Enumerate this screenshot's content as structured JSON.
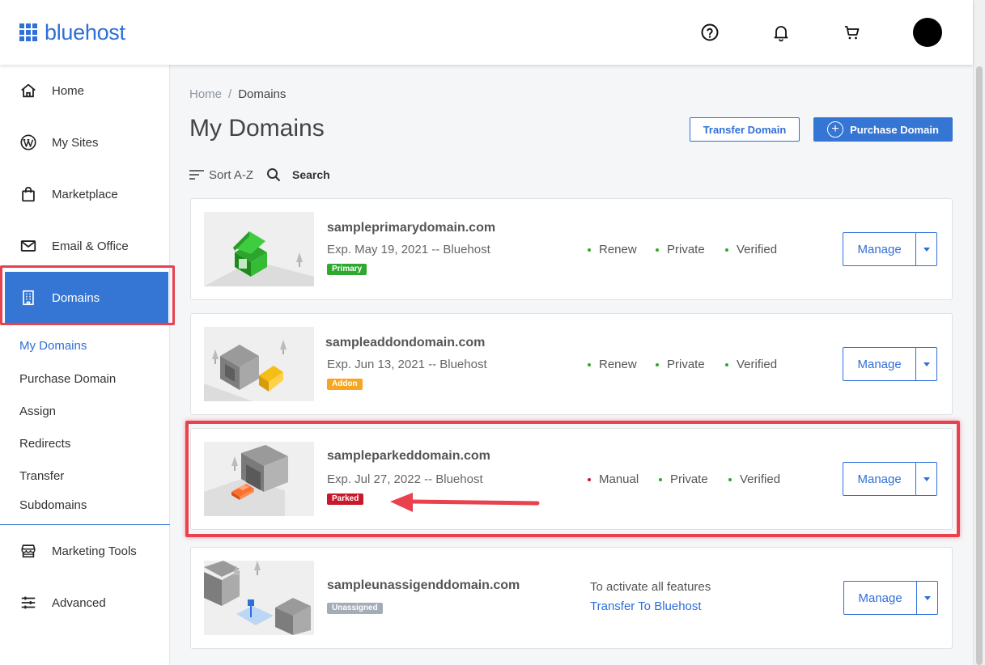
{
  "header": {
    "logo_text": "bluehost",
    "icons": [
      "help-icon",
      "bell-icon",
      "cart-icon",
      "avatar"
    ]
  },
  "sidebar": {
    "items": [
      {
        "label": "Home",
        "icon": "home-icon"
      },
      {
        "label": "My Sites",
        "icon": "wordpress-icon"
      },
      {
        "label": "Marketplace",
        "icon": "shopping-bag-icon"
      },
      {
        "label": "Email & Office",
        "icon": "envelope-icon"
      },
      {
        "label": "Domains",
        "icon": "building-icon"
      },
      {
        "label": "Marketing Tools",
        "icon": "storefront-icon"
      },
      {
        "label": "Advanced",
        "icon": "sliders-icon"
      }
    ],
    "sub_items": [
      "My Domains",
      "Purchase Domain",
      "Assign",
      "Redirects",
      "Transfer",
      "Subdomains"
    ]
  },
  "breadcrumb": {
    "home": "Home",
    "separator": "/",
    "current": "Domains"
  },
  "page_title": "My Domains",
  "buttons": {
    "transfer": "Transfer Domain",
    "purchase": "Purchase Domain",
    "plus": "+"
  },
  "toolbar": {
    "sort": "Sort A-Z",
    "search": "Search"
  },
  "domains": [
    {
      "name": "sampleprimarydomain.com",
      "expiry": "Exp. May 19, 2021 -- Bluehost",
      "tag": "Primary",
      "tag_color": "#2ea82e",
      "statuses": [
        {
          "label": "Renew",
          "color": "#2ea82e"
        },
        {
          "label": "Private",
          "color": "#2ea82e"
        },
        {
          "label": "Verified",
          "color": "#2ea82e"
        }
      ],
      "manage": "Manage"
    },
    {
      "name": "sampleaddondomain.com",
      "expiry": "Exp. Jun 13, 2021 -- Bluehost",
      "tag": "Addon",
      "tag_color": "#f5a623",
      "statuses": [
        {
          "label": "Renew",
          "color": "#2ea82e"
        },
        {
          "label": "Private",
          "color": "#2ea82e"
        },
        {
          "label": "Verified",
          "color": "#2ea82e"
        }
      ],
      "manage": "Manage"
    },
    {
      "name": "sampleparkeddomain.com",
      "expiry": "Exp. Jul 27, 2022 -- Bluehost",
      "tag": "Parked",
      "tag_color": "#c9172b",
      "statuses": [
        {
          "label": "Manual",
          "color": "#c9172b"
        },
        {
          "label": "Private",
          "color": "#2ea82e"
        },
        {
          "label": "Verified",
          "color": "#2ea82e"
        }
      ],
      "manage": "Manage"
    },
    {
      "name": "sampleunassigenddomain.com",
      "tag": "Unassigned",
      "tag_color": "#a3acb7",
      "activate_text": "To activate all features",
      "transfer_link": "Transfer To Bluehost",
      "manage": "Manage"
    }
  ],
  "colors": {
    "accent": "#3575d3",
    "highlight": "#e9414d"
  }
}
